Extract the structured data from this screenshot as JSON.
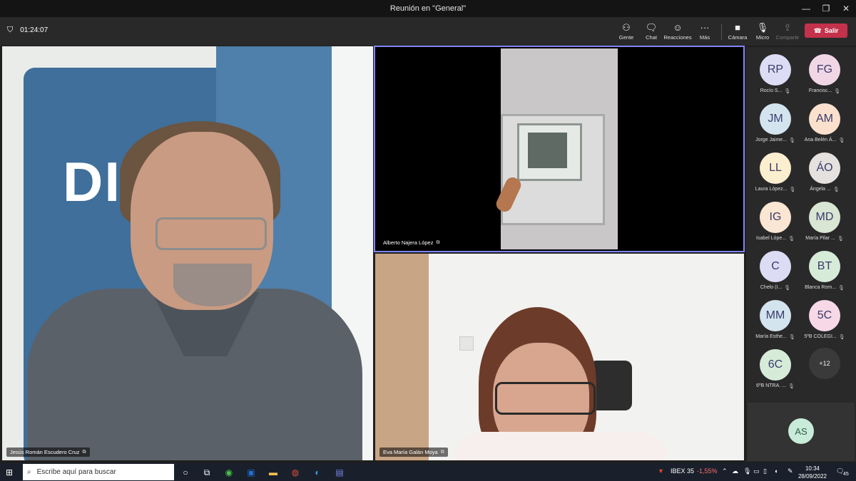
{
  "window": {
    "title": "Reunión en \"General\"",
    "controls": [
      "—",
      "❐",
      "✕"
    ]
  },
  "toolbar": {
    "timer": "01:24:07",
    "buttons": [
      {
        "label": "Gente",
        "icon": "people-icon"
      },
      {
        "label": "Chat",
        "icon": "chat-icon"
      },
      {
        "label": "Reacciones",
        "icon": "reactions-icon"
      },
      {
        "label": "Más",
        "icon": "more-icon"
      },
      {
        "label": "Cámara",
        "icon": "camera-icon"
      },
      {
        "label": "Micro",
        "icon": "mic-off-icon"
      },
      {
        "label": "Compartir",
        "icon": "share-icon"
      }
    ],
    "leave_label": "Salir"
  },
  "tiles": [
    {
      "name": "Jesús Román Escudero Cruz",
      "banner_text": "DIV    A"
    },
    {
      "name": "Alberto Najera López"
    },
    {
      "name": "Eva María Galán Moya"
    }
  ],
  "participants": [
    {
      "initials": "RP",
      "name": "Rocío S...",
      "color": "#dcdcf5"
    },
    {
      "initials": "FG",
      "name": "Francisc...",
      "color": "#f1d7e6"
    },
    {
      "initials": "JM",
      "name": "Jorge Jaime...",
      "color": "#d3e4ef"
    },
    {
      "initials": "AM",
      "name": "Ana Belén Á...",
      "color": "#fbe0cd"
    },
    {
      "initials": "LL",
      "name": "Laura López...",
      "color": "#fbefcf"
    },
    {
      "initials": "ÁO",
      "name": "Ángela ...",
      "color": "#e5e1df"
    },
    {
      "initials": "IG",
      "name": "Isabel Lópe...",
      "color": "#fbe6d3"
    },
    {
      "initials": "MD",
      "name": "María Pilar ...",
      "color": "#d9e6d3"
    },
    {
      "initials": "C",
      "name": "Chelo (I...",
      "color": "#dcdcf5"
    },
    {
      "initials": "BT",
      "name": "Blanca Rom...",
      "color": "#d6ecd9"
    },
    {
      "initials": "MM",
      "name": "María Esthe...",
      "color": "#d3e4ef"
    },
    {
      "initials": "5C",
      "name": "5ºB COLEGI...",
      "color": "#f6d8e6"
    },
    {
      "initials": "6C",
      "name": "6ºB NTRA. ...",
      "color": "#d6ecd9"
    }
  ],
  "more_participants": "+12",
  "self": {
    "initials": "AS"
  },
  "taskbar": {
    "search_placeholder": "Escribe aquí para buscar",
    "stock_name": "IBEX 35",
    "stock_change": "-1,55%",
    "time": "10:34",
    "date": "28/09/2022",
    "notifications": "45"
  }
}
